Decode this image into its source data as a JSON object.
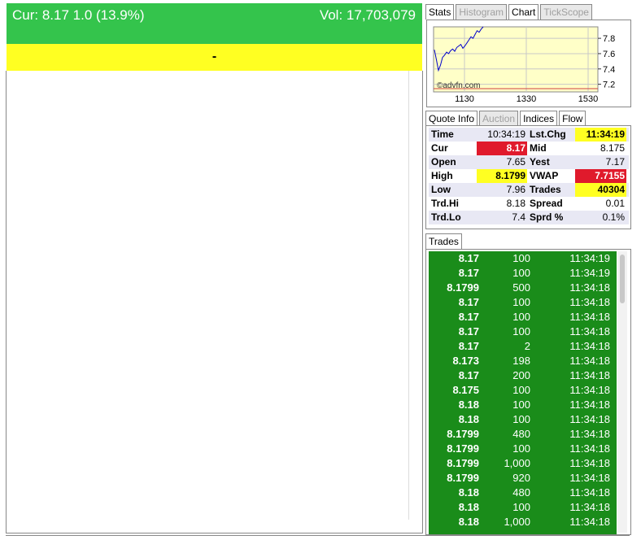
{
  "banner": {
    "cur": "Cur: 8.17  1.0  (13.9%)",
    "vol": "Vol: 17,703,079",
    "status": "-"
  },
  "colors": {
    "up_green": "#34c44c",
    "trade_green": "#1a8c1a",
    "highlight_yellow": "#ffff22",
    "alert_red": "#e01a2c"
  },
  "chart_tabs": [
    {
      "label": "Stats",
      "state": "normal"
    },
    {
      "label": "Histogram",
      "state": "disabled"
    },
    {
      "label": "Chart",
      "state": "active"
    },
    {
      "label": "TickScope",
      "state": "disabled"
    }
  ],
  "chart": {
    "watermark": "©advfn.com",
    "y_ticks": [
      "7.8",
      "7.6",
      "7.4",
      "7.2"
    ],
    "x_ticks": [
      "1130",
      "1330",
      "1530"
    ]
  },
  "chart_data": {
    "type": "line",
    "x_ticks": [
      "1130",
      "1330",
      "1530"
    ],
    "y_ticks": [
      7.8,
      7.6,
      7.4,
      7.2
    ],
    "ylim": [
      7.1,
      7.95
    ],
    "series": [
      {
        "values": [
          7.65,
          7.52,
          7.38,
          7.45,
          7.55,
          7.58,
          7.62,
          7.6,
          7.64,
          7.66,
          7.63,
          7.68,
          7.7,
          7.72,
          7.67,
          7.7,
          7.74,
          7.78,
          7.82,
          7.8,
          7.85,
          7.9,
          7.88,
          7.92,
          7.95
        ]
      }
    ]
  },
  "quote_tabs": [
    {
      "label": "Quote Info",
      "state": "active"
    },
    {
      "label": "Auction",
      "state": "disabled"
    },
    {
      "label": "Indices",
      "state": "normal"
    },
    {
      "label": "Flow",
      "state": "normal"
    }
  ],
  "quote": {
    "rows": [
      {
        "l1": "Time",
        "v1": "10:34:19",
        "v1hl": "",
        "l2": "Lst.Chg",
        "v2": "11:34:19",
        "v2hl": "yellow"
      },
      {
        "l1": "Cur",
        "v1": "8.17",
        "v1hl": "red",
        "l2": "Mid",
        "v2": "8.175",
        "v2hl": ""
      },
      {
        "l1": "Open",
        "v1": "7.65",
        "v1hl": "",
        "l2": "Yest",
        "v2": "7.17",
        "v2hl": ""
      },
      {
        "l1": "High",
        "v1": "8.1799",
        "v1hl": "yellow",
        "l2": "VWAP",
        "v2": "7.7155",
        "v2hl": "red"
      },
      {
        "l1": "Low",
        "v1": "7.96",
        "v1hl": "",
        "l2": "Trades",
        "v2": "40304",
        "v2hl": "yellow"
      },
      {
        "l1": "Trd.Hi",
        "v1": "8.18",
        "v1hl": "",
        "l2": "Spread",
        "v2": "0.01",
        "v2hl": ""
      },
      {
        "l1": "Trd.Lo",
        "v1": "7.4",
        "v1hl": "",
        "l2": "Sprd %",
        "v2": "0.1%",
        "v2hl": ""
      }
    ]
  },
  "trades_tab": "Trades",
  "trades": [
    [
      "8.17",
      "100",
      "11:34:19"
    ],
    [
      "8.17",
      "100",
      "11:34:19"
    ],
    [
      "8.1799",
      "500",
      "11:34:18"
    ],
    [
      "8.17",
      "100",
      "11:34:18"
    ],
    [
      "8.17",
      "100",
      "11:34:18"
    ],
    [
      "8.17",
      "100",
      "11:34:18"
    ],
    [
      "8.17",
      "2",
      "11:34:18"
    ],
    [
      "8.173",
      "198",
      "11:34:18"
    ],
    [
      "8.17",
      "200",
      "11:34:18"
    ],
    [
      "8.175",
      "100",
      "11:34:18"
    ],
    [
      "8.18",
      "100",
      "11:34:18"
    ],
    [
      "8.18",
      "100",
      "11:34:18"
    ],
    [
      "8.1799",
      "480",
      "11:34:18"
    ],
    [
      "8.1799",
      "100",
      "11:34:18"
    ],
    [
      "8.1799",
      "1,000",
      "11:34:18"
    ],
    [
      "8.1799",
      "920",
      "11:34:18"
    ],
    [
      "8.18",
      "480",
      "11:34:18"
    ],
    [
      "8.18",
      "100",
      "11:34:18"
    ],
    [
      "8.18",
      "1,000",
      "11:34:18"
    ]
  ]
}
